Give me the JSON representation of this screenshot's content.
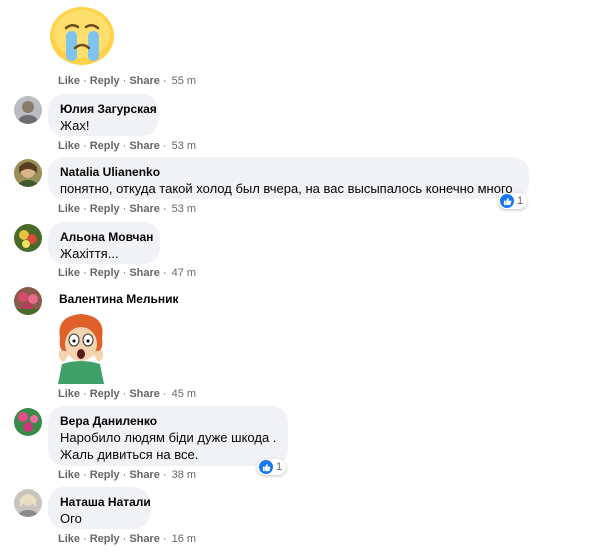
{
  "actions": {
    "like": "Like",
    "reply": "Reply",
    "share": "Share",
    "sep": "·"
  },
  "comments": [
    {
      "name": "",
      "sticker": "crying-face-sticker",
      "time": "55 m"
    },
    {
      "name": "Юлия Загурская",
      "lines": [
        "Жах!"
      ],
      "time": "53 m"
    },
    {
      "name": "Natalia Ulianenko",
      "lines": [
        "понятно, откуда такой холод был вчера, на вас высыпалось конечно много"
      ],
      "time": "53 m",
      "reactions": "1"
    },
    {
      "name": "Альона Мовчан",
      "lines": [
        "Жахіття..."
      ],
      "time": "47 m"
    },
    {
      "name": "Валентина Мельник",
      "sticker": "cartoon-woman-sticker",
      "time": "45 m"
    },
    {
      "name": "Вера Даниленко",
      "lines": [
        "Наробило людям біди дуже шкода .",
        "Жаль дивиться на все."
      ],
      "time": "38 m",
      "reactions": "1"
    },
    {
      "name": "Наташа Натали",
      "lines": [
        "Ого"
      ],
      "time": "16 m"
    }
  ],
  "colors": {
    "bubble": "#f0f2f5",
    "like_blue": "#1877f2",
    "meta_gray": "#65676b"
  }
}
